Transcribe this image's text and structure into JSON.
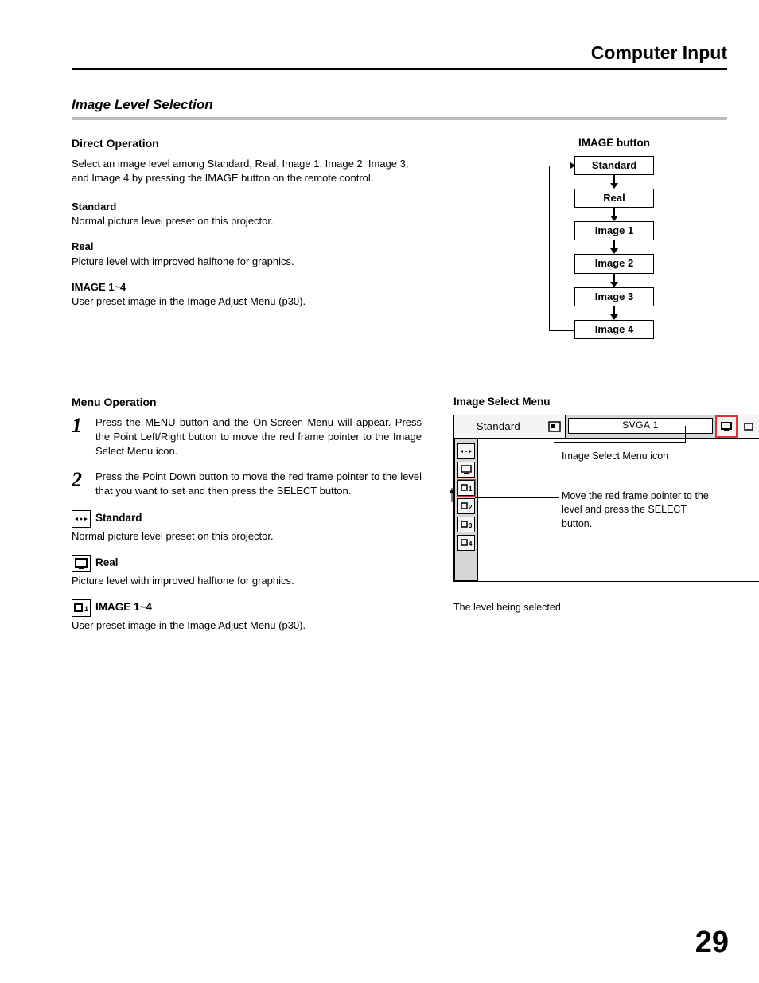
{
  "page": {
    "header": "Computer Input",
    "section": "Image Level Selection",
    "number": "29"
  },
  "direct": {
    "heading": "Direct Operation",
    "intro": "Select an image level among Standard, Real, Image 1, Image 2, Image 3, and Image 4 by pressing the IMAGE button on the remote control.",
    "defs": [
      {
        "term": "Standard",
        "body": "Normal picture level preset on this projector."
      },
      {
        "term": "Real",
        "body": "Picture level with improved halftone for graphics."
      },
      {
        "term": "IMAGE 1~4",
        "body": "User preset image in the Image Adjust Menu (p30)."
      }
    ]
  },
  "flow": {
    "title": "IMAGE button",
    "items": [
      "Standard",
      "Real",
      "Image 1",
      "Image 2",
      "Image 3",
      "Image 4"
    ]
  },
  "menu_op": {
    "heading": "Menu Operation",
    "steps": [
      "Press the MENU button and the On-Screen Menu will appear. Press the Point Left/Right button to move the red frame pointer to the Image Select Menu icon.",
      "Press the Point Down button to move the red frame pointer to the level that you want to set and then press the SELECT button."
    ],
    "icons": [
      {
        "label": "Standard",
        "body": "Normal picture level preset on this projector."
      },
      {
        "label": "Real",
        "body": "Picture level with improved halftone for graphics."
      },
      {
        "label": "IMAGE 1~4",
        "body": "User preset image in the Image Adjust Menu (p30)."
      }
    ]
  },
  "menu_diag": {
    "title": "Image Select Menu",
    "bar_label": "Standard",
    "signal": "SVGA 1",
    "callout1": "Image Select Menu icon",
    "callout2": "Move the red frame pointer to the level and press the SELECT button.",
    "note": "The level being selected.",
    "side_icons": [
      "",
      "",
      "1",
      "2",
      "3",
      "4"
    ]
  }
}
